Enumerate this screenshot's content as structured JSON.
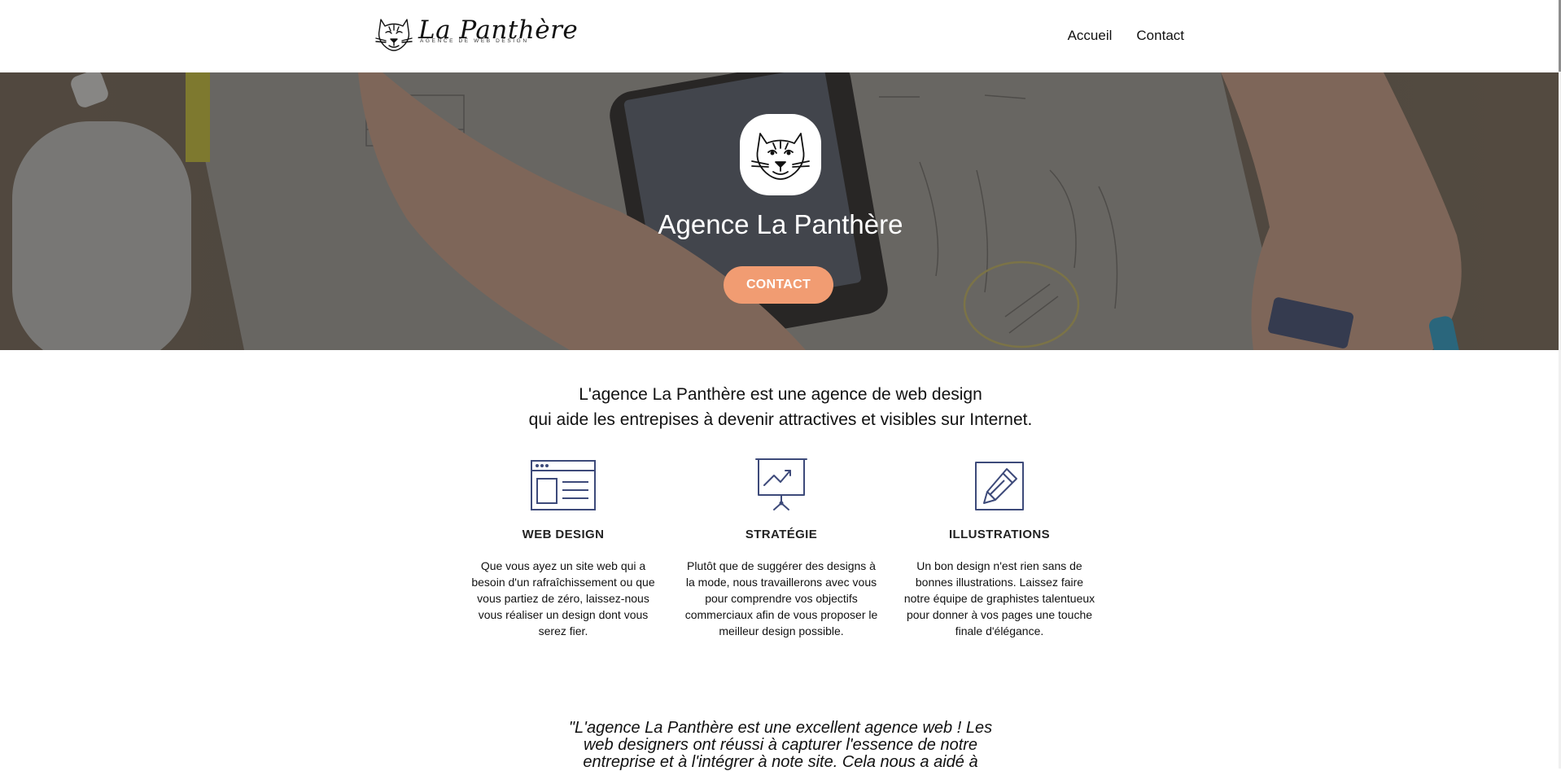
{
  "header": {
    "logo": {
      "title": "La Panthère",
      "tagline": "AGENCE DE WEB DESIGN",
      "icon": "panther-head-icon"
    },
    "nav": [
      {
        "label": "Accueil"
      },
      {
        "label": "Contact"
      }
    ]
  },
  "hero": {
    "emblem_icon": "panther-head-icon",
    "title": "Agence La Panthère",
    "cta_label": "CONTACT"
  },
  "intro": {
    "line1": "L'agence La Panthère est une agence de web design",
    "line2": "qui aide les entrepises à devenir attractives et visibles sur Internet."
  },
  "services": [
    {
      "icon": "browser-window-icon",
      "title": "WEB DESIGN",
      "text": "Que vous ayez un site web qui a besoin d'un rafraîchissement ou que vous partiez de zéro, laissez-nous vous réaliser un design dont vous serez fier."
    },
    {
      "icon": "presentation-chart-icon",
      "title": "STRATÉGIE",
      "text": "Plutôt que de suggérer des designs à la mode, nous travaillerons avec vous pour comprendre vos objectifs commerciaux afin de vous proposer le meilleur design possible."
    },
    {
      "icon": "pencil-square-icon",
      "title": "ILLUSTRATIONS",
      "text": "Un bon design n'est rien sans de bonnes illustrations. Laissez faire notre équipe de graphistes talentueux pour donner à vos pages une touche finale d'élégance."
    }
  ],
  "testimonial": {
    "text": "\"L'agence La Panthère est une excellent agence web ! Les web designers ont réussi à capturer l'essence de notre entreprise et à l'intégrer à note site. Cela nous a aidé à"
  },
  "colors": {
    "accent": "#f19c72",
    "icon_stroke": "#3d4a7a",
    "text": "#111111",
    "background": "#ffffff"
  }
}
